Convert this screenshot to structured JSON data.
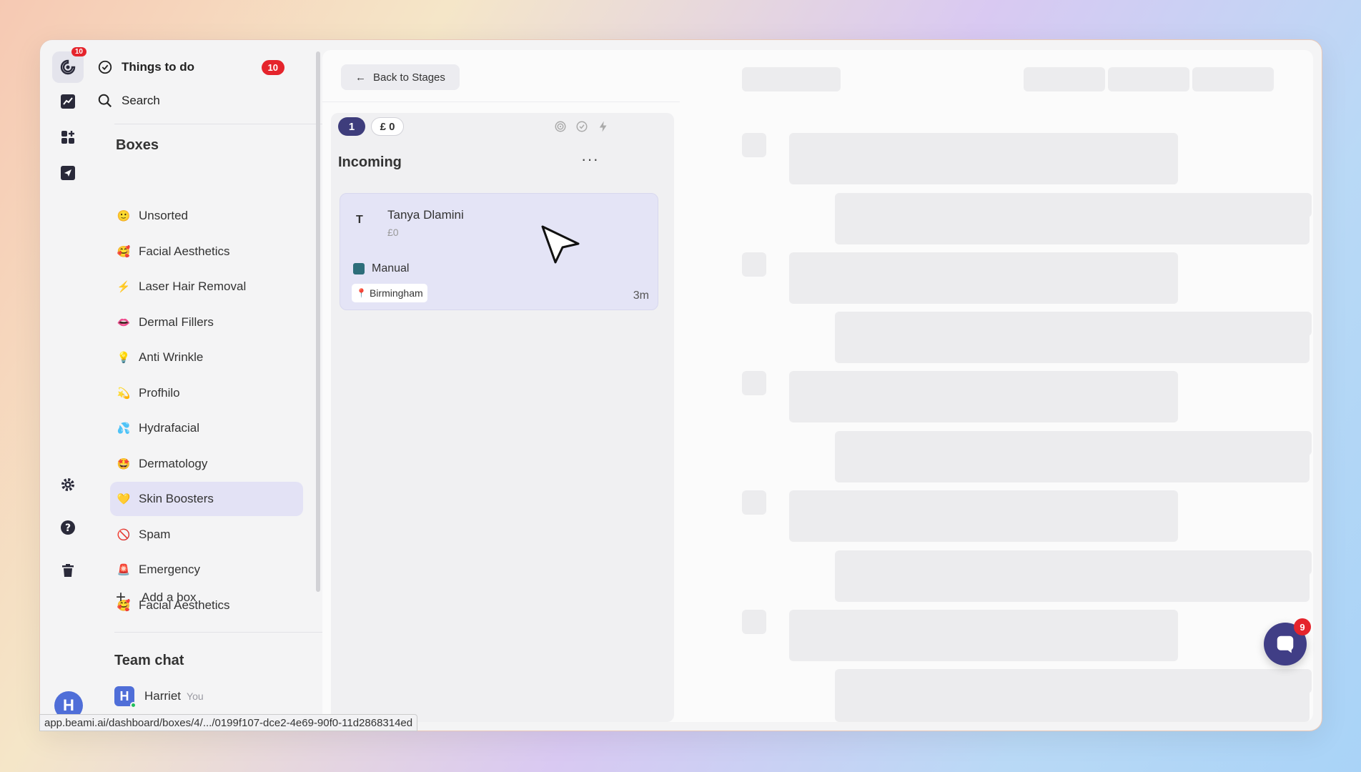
{
  "rail": {
    "logo_badge": "10",
    "icons": [
      "app-logo-icon",
      "chart-icon",
      "apps-add-icon",
      "send-icon",
      "gear-icon",
      "help-icon",
      "trash-icon"
    ],
    "avatar_initial": "H"
  },
  "sidebar": {
    "things_to_do": "Things to do",
    "things_to_do_count": "10",
    "search": "Search",
    "boxes_title": "Boxes",
    "boxes": [
      {
        "emoji": "🙂",
        "label": "Unsorted"
      },
      {
        "emoji": "🥰",
        "label": "Facial Aesthetics"
      },
      {
        "emoji": "⚡",
        "label": "Laser Hair Removal"
      },
      {
        "emoji": "👄",
        "label": "Dermal Fillers"
      },
      {
        "emoji": "💡",
        "label": "Anti Wrinkle"
      },
      {
        "emoji": "💫",
        "label": "Profhilo"
      },
      {
        "emoji": "💦",
        "label": "Hydrafacial"
      },
      {
        "emoji": "🤩",
        "label": "Dermatology"
      },
      {
        "emoji": "💛",
        "label": "Skin Boosters"
      },
      {
        "emoji": "🚫",
        "label": "Spam"
      },
      {
        "emoji": "🚨",
        "label": "Emergency"
      },
      {
        "emoji": "🥰",
        "label": "Facial Aesthetics"
      }
    ],
    "active_box": "Skin Boosters",
    "add_box": "Add a box",
    "team_chat_title": "Team chat",
    "team_member": {
      "initial": "H",
      "name": "Harriet",
      "tag": "You"
    }
  },
  "main": {
    "back_button": "Back to Stages",
    "stage": {
      "count": "1",
      "value": "£ 0",
      "title": "Incoming",
      "more": "···",
      "card": {
        "initial": "T",
        "name": "Tanya Dlamini",
        "amount": "£0",
        "source": "Manual",
        "location": "Birmingham",
        "time": "3m"
      }
    }
  },
  "chat_fab": {
    "badge": "9"
  },
  "status_url": "app.beami.ai/dashboard/boxes/4/.../0199f107-dce2-4e69-90f0-11d2868314ed",
  "colors": {
    "accent": "#3e3d7c",
    "badge": "#e5242c",
    "active_bg": "#e3e2f5"
  }
}
